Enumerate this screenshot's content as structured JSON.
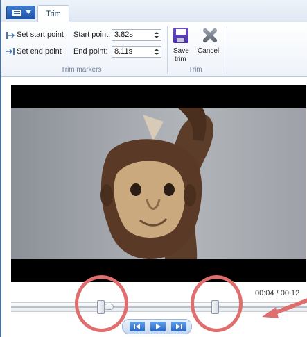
{
  "ribbon": {
    "active_tab": "Trim",
    "set_start_label": "Set start point",
    "set_end_label": "Set end point",
    "start_point_label": "Start point:",
    "start_point_value": "3.82s",
    "end_point_label": "End point:",
    "end_point_value": "8.11s",
    "save_label_line1": "Save",
    "save_label_line2": "trim",
    "cancel_label": "Cancel",
    "group_trim_markers": "Trim markers",
    "group_trim": "Trim"
  },
  "player": {
    "time_readout": "00:04 / 00:12"
  },
  "colors": {
    "annotation": "#df6e6e",
    "accent": "#2466c6"
  }
}
